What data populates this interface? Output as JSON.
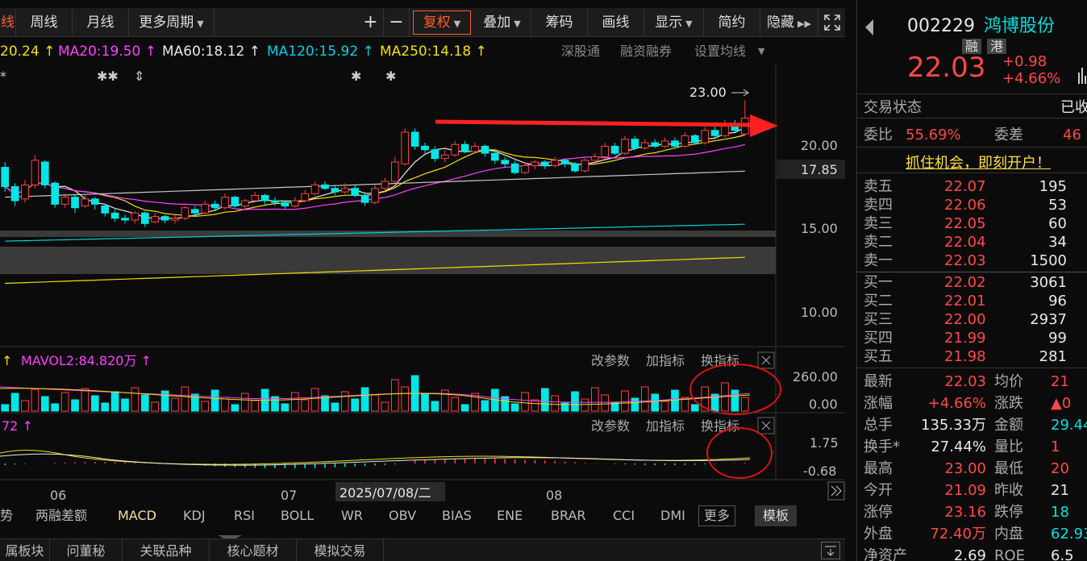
{
  "toolbar": {
    "items": [
      {
        "label": "线"
      },
      {
        "label": "周线"
      },
      {
        "label": "月线"
      },
      {
        "label": "更多周期",
        "caret": "▼"
      },
      {
        "label": "+"
      },
      {
        "label": "−"
      },
      {
        "label": "复权",
        "caret": "▼"
      },
      {
        "label": "叠加",
        "caret": "▼"
      },
      {
        "label": "筹码"
      },
      {
        "label": "画线"
      },
      {
        "label": "显示",
        "caret": "▼"
      },
      {
        "label": "简约"
      },
      {
        "label": "隐藏",
        "caret": "▶▶"
      }
    ],
    "active_color": "#ff5a2a"
  },
  "ma_legend": {
    "ma10": "20.24 ↑",
    "ma20": "MA20:19.50 ↑",
    "ma60": "MA60:18.12 ↑",
    "ma120": "MA120:15.92 ↑",
    "ma250": "MA250:14.18 ↑",
    "links": [
      "深股通",
      "融资融券",
      "设置均线"
    ]
  },
  "price_axis": {
    "labels": [
      "20.00",
      "17.85",
      "15.00",
      "10.00"
    ],
    "high_label": "23.00"
  },
  "vol_panel": {
    "legend": "MAVOL2:84.820万 ↑",
    "prefix": "↑",
    "axis": [
      "260.00",
      "0.00"
    ],
    "buttons": [
      "改参数",
      "加指标",
      "换指标"
    ]
  },
  "macd_panel": {
    "legend": "72 ↑",
    "axis": [
      "1.75",
      "-0.68"
    ],
    "buttons": [
      "改参数",
      "加指标",
      "换指标"
    ]
  },
  "date_axis": {
    "labels": [
      "06",
      "07",
      "08"
    ],
    "cursor_date": "2025/07/08/二"
  },
  "indicator_tabs": [
    "势",
    "两融差额",
    "MACD",
    "KDJ",
    "RSI",
    "BOLL",
    "WR",
    "OBV",
    "BIAS",
    "ENE",
    "BRAR",
    "CCI",
    "DMI",
    "更多",
    "模板"
  ],
  "bottom_tabs": [
    "属板块",
    "问董秘",
    "关联品种",
    "核心题材",
    "模拟交易"
  ],
  "chart_data": {
    "type": "candlestick",
    "ylim": [
      9,
      24.5
    ],
    "high_annotation": 23.0,
    "candles": [
      [
        19.2,
        18.1,
        19.5,
        17.8
      ],
      [
        18.1,
        17.3,
        18.3,
        17.0
      ],
      [
        17.4,
        18.2,
        18.5,
        17.2
      ],
      [
        18.2,
        19.6,
        19.9,
        18.0
      ],
      [
        19.5,
        18.2,
        19.6,
        18.0
      ],
      [
        18.3,
        17.1,
        18.4,
        16.9
      ],
      [
        17.1,
        17.5,
        17.7,
        16.9
      ],
      [
        17.5,
        16.9,
        17.6,
        16.6
      ],
      [
        17.0,
        17.4,
        17.6,
        16.9
      ],
      [
        17.4,
        17.1,
        17.5,
        16.8
      ],
      [
        17.0,
        16.6,
        17.1,
        16.4
      ],
      [
        16.6,
        16.3,
        16.8,
        16.1
      ],
      [
        16.3,
        16.2,
        16.5,
        16.0
      ],
      [
        16.2,
        16.6,
        16.7,
        16.0
      ],
      [
        16.6,
        16.0,
        16.7,
        15.8
      ],
      [
        16.1,
        16.4,
        16.6,
        16.0
      ],
      [
        16.4,
        16.2,
        16.5,
        16.0
      ],
      [
        16.2,
        16.3,
        16.5,
        16.0
      ],
      [
        16.3,
        16.9,
        17.0,
        16.2
      ],
      [
        16.8,
        16.6,
        17.0,
        16.4
      ],
      [
        16.6,
        17.1,
        17.3,
        16.5
      ],
      [
        17.1,
        16.9,
        17.3,
        16.7
      ],
      [
        16.9,
        17.5,
        17.7,
        16.8
      ],
      [
        17.5,
        17.0,
        17.6,
        16.9
      ],
      [
        17.0,
        17.3,
        17.4,
        16.8
      ],
      [
        17.3,
        17.6,
        17.8,
        17.2
      ],
      [
        17.6,
        17.3,
        17.7,
        17.1
      ],
      [
        17.3,
        17.2,
        17.5,
        17.0
      ],
      [
        17.2,
        17.0,
        17.3,
        16.8
      ],
      [
        17.0,
        17.3,
        17.5,
        16.9
      ],
      [
        17.3,
        17.7,
        17.9,
        17.2
      ],
      [
        17.7,
        18.2,
        18.4,
        17.6
      ],
      [
        18.2,
        18.0,
        18.4,
        17.9
      ],
      [
        18.0,
        17.8,
        18.2,
        17.6
      ],
      [
        17.8,
        18.0,
        18.3,
        17.7
      ],
      [
        18.0,
        17.6,
        18.2,
        17.5
      ],
      [
        17.6,
        17.2,
        17.8,
        17.0
      ],
      [
        17.2,
        18.0,
        18.2,
        17.1
      ],
      [
        18.0,
        18.4,
        18.6,
        17.9
      ],
      [
        18.4,
        19.5,
        19.8,
        18.3
      ],
      [
        19.4,
        21.2,
        21.4,
        19.3
      ],
      [
        21.2,
        20.4,
        21.4,
        20.2
      ],
      [
        20.4,
        20.2,
        20.6,
        20.0
      ],
      [
        20.2,
        19.7,
        20.4,
        19.5
      ],
      [
        19.7,
        19.9,
        20.2,
        19.5
      ],
      [
        19.9,
        20.5,
        20.7,
        19.8
      ],
      [
        20.5,
        20.1,
        20.7,
        20.0
      ],
      [
        20.1,
        20.4,
        20.6,
        20.0
      ],
      [
        20.4,
        20.0,
        20.5,
        19.8
      ],
      [
        20.0,
        19.6,
        20.2,
        19.4
      ],
      [
        19.6,
        19.4,
        19.8,
        19.2
      ],
      [
        19.4,
        18.9,
        19.6,
        18.8
      ],
      [
        18.9,
        19.3,
        19.5,
        18.8
      ],
      [
        19.3,
        19.5,
        19.6,
        19.1
      ],
      [
        19.5,
        19.3,
        19.6,
        19.1
      ],
      [
        19.3,
        19.6,
        19.8,
        19.2
      ],
      [
        19.6,
        19.4,
        19.7,
        19.2
      ],
      [
        19.4,
        19.0,
        19.5,
        18.9
      ],
      [
        19.0,
        19.6,
        19.7,
        18.9
      ],
      [
        19.6,
        19.8,
        20.0,
        19.5
      ],
      [
        19.8,
        20.4,
        20.6,
        19.7
      ],
      [
        20.4,
        20.0,
        20.6,
        19.9
      ],
      [
        20.0,
        20.8,
        21.0,
        19.9
      ],
      [
        20.8,
        20.3,
        21.0,
        20.2
      ],
      [
        20.3,
        20.6,
        20.8,
        20.2
      ],
      [
        20.6,
        20.4,
        20.8,
        20.3
      ],
      [
        20.4,
        20.7,
        20.9,
        20.3
      ],
      [
        20.7,
        20.4,
        20.9,
        20.3
      ],
      [
        20.4,
        21.0,
        21.2,
        20.3
      ],
      [
        21.0,
        20.6,
        21.1,
        20.5
      ],
      [
        20.6,
        21.3,
        21.5,
        20.5
      ],
      [
        21.3,
        21.0,
        21.5,
        20.9
      ],
      [
        21.0,
        21.7,
        21.9,
        20.9
      ],
      [
        21.7,
        21.3,
        21.9,
        21.2
      ],
      [
        21.1,
        22.0,
        23.0,
        21.0
      ]
    ],
    "ma_series": [
      {
        "name": "MA20",
        "color": "#ff40ff"
      },
      {
        "name": "MA60",
        "color": "#e8e8e8"
      },
      {
        "name": "MA120",
        "color": "#00d0e0"
      },
      {
        "name": "MA250",
        "color": "#f0e000"
      }
    ]
  },
  "stock": {
    "code": "002229",
    "name": "鸿博股份",
    "tags": [
      "融",
      "港"
    ],
    "price": "22.03",
    "change": "+0.98",
    "change_pct": "+4.66%",
    "status_label": "交易状态",
    "status_value": "已收",
    "weibi_label": "委比",
    "weibi": "55.69%",
    "weicha_label": "委差",
    "weicha": "46",
    "promo": "抓住机会，即刻开户！"
  },
  "order_book": {
    "sell": [
      {
        "label": "卖五",
        "price": "22.07",
        "vol": "195"
      },
      {
        "label": "卖四",
        "price": "22.06",
        "vol": "53"
      },
      {
        "label": "卖三",
        "price": "22.05",
        "vol": "60"
      },
      {
        "label": "卖二",
        "price": "22.04",
        "vol": "34"
      },
      {
        "label": "卖一",
        "price": "22.03",
        "vol": "1500"
      }
    ],
    "buy": [
      {
        "label": "买一",
        "price": "22.02",
        "vol": "3061"
      },
      {
        "label": "买二",
        "price": "22.01",
        "vol": "96"
      },
      {
        "label": "买三",
        "price": "22.00",
        "vol": "2937"
      },
      {
        "label": "买四",
        "price": "21.99",
        "vol": "99"
      },
      {
        "label": "买五",
        "price": "21.98",
        "vol": "281"
      }
    ]
  },
  "stats": [
    {
      "l1": "最新",
      "v1": "22.03",
      "c1": "red",
      "l2": "均价",
      "v2": "21",
      "c2": "red"
    },
    {
      "l1": "涨幅",
      "v1": "+4.66%",
      "c1": "red",
      "l2": "涨跌",
      "v2": "▲0",
      "c2": "red"
    },
    {
      "l1": "总手",
      "v1": "135.33万",
      "c1": "wht",
      "l2": "金额",
      "v2": "29.44",
      "c2": "cyan"
    },
    {
      "l1": "换手*",
      "v1": "27.44%",
      "c1": "wht",
      "l2": "量比",
      "v2": "1",
      "c2": "red"
    },
    {
      "l1": "最高",
      "v1": "23.00",
      "c1": "red",
      "l2": "最低",
      "v2": "20",
      "c2": "red"
    },
    {
      "l1": "今开",
      "v1": "21.09",
      "c1": "red",
      "l2": "昨收",
      "v2": "21",
      "c2": "wht"
    },
    {
      "l1": "涨停",
      "v1": "23.16",
      "c1": "red",
      "l2": "跌停",
      "v2": "18",
      "c2": "cyan"
    },
    {
      "l1": "外盘",
      "v1": "72.40万",
      "c1": "red",
      "l2": "内盘",
      "v2": "62.93",
      "c2": "cyan"
    },
    {
      "l1": "净资产",
      "v1": "2.69",
      "c1": "wht",
      "l2": "ROE",
      "v2": "6.5",
      "c2": "wht"
    }
  ]
}
